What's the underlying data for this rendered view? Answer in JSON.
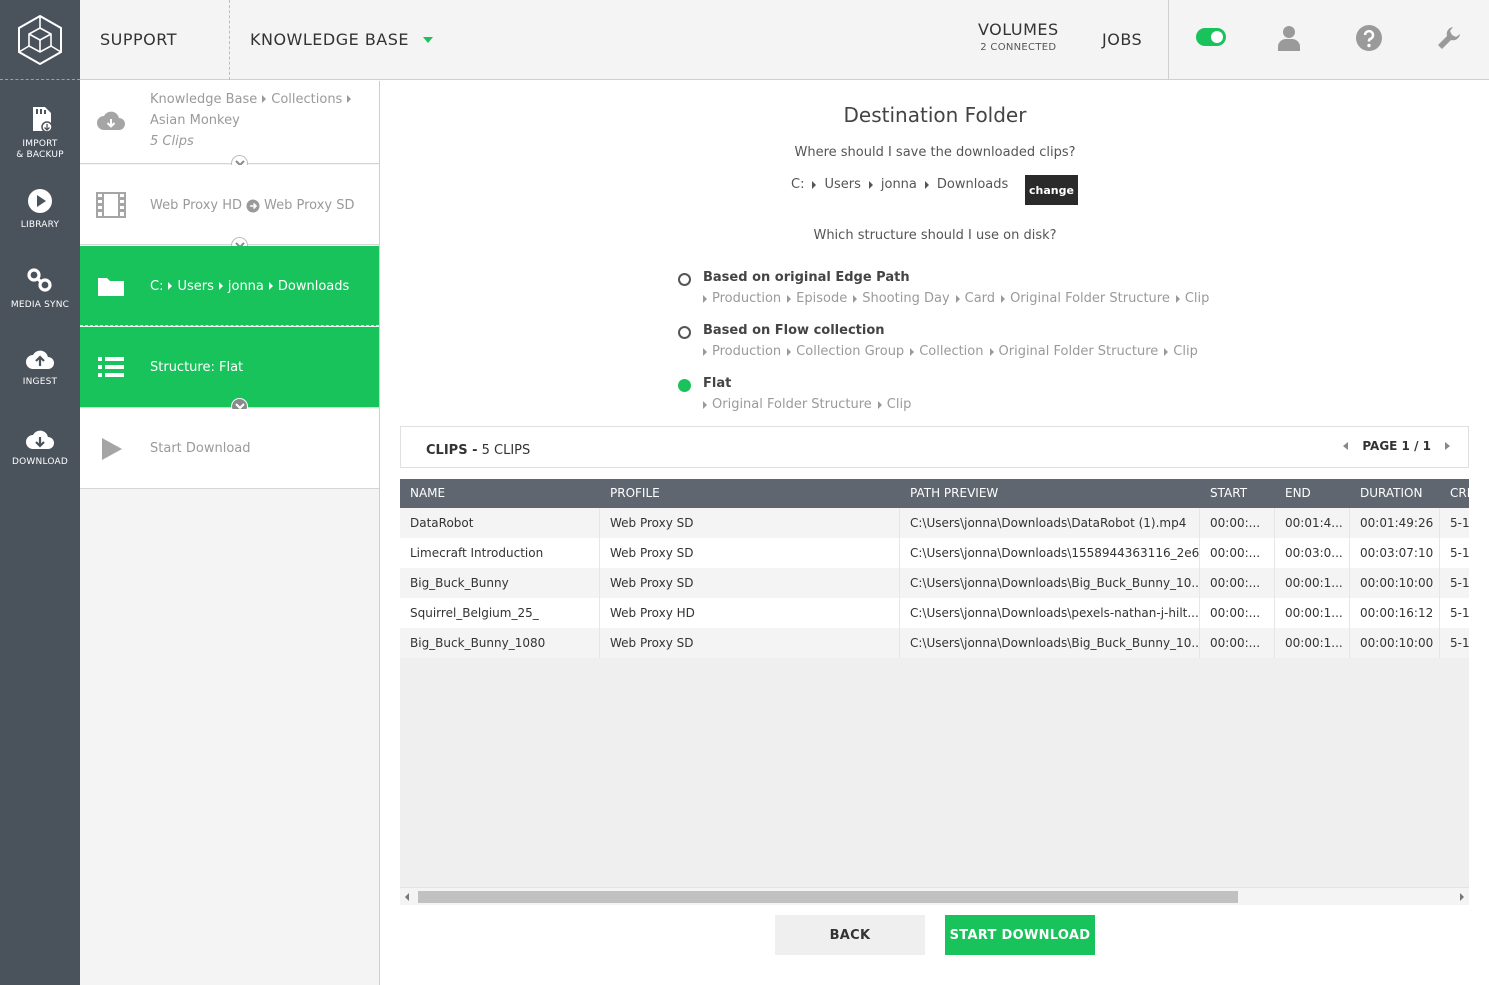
{
  "rail": {
    "items": [
      {
        "label": "IMPORT\n& BACKUP",
        "icon": "sd-card-icon"
      },
      {
        "label": "LIBRARY",
        "icon": "play-circle-icon"
      },
      {
        "label": "MEDIA SYNC",
        "icon": "link-icon"
      },
      {
        "label": "INGEST",
        "icon": "cloud-upload-icon"
      },
      {
        "label": "DOWNLOAD",
        "icon": "cloud-download-icon"
      }
    ]
  },
  "topbar": {
    "support": "SUPPORT",
    "knowledge_base": "KNOWLEDGE BASE",
    "volumes": "VOLUMES",
    "volumes_sub": "2 CONNECTED",
    "jobs": "JOBS"
  },
  "steps": {
    "source": {
      "crumb1": "Knowledge Base",
      "crumb2": "Collections",
      "crumb3": "Asian Monkey",
      "count": "5 Clips"
    },
    "profile": {
      "from": "Web Proxy HD",
      "to": "Web Proxy SD"
    },
    "folder": {
      "p1": "C:",
      "p2": "Users",
      "p3": "jonna",
      "p4": "Downloads"
    },
    "structure": "Structure: Flat",
    "start": "Start Download"
  },
  "destination": {
    "title": "Destination Folder",
    "question": "Where should I save the downloaded clips?",
    "path": [
      "C:",
      "Users",
      "jonna",
      "Downloads"
    ],
    "change": "change",
    "structure_question": "Which structure should I use on disk?",
    "options": [
      {
        "label": "Based on original Edge Path",
        "path": [
          "Production",
          "Episode",
          "Shooting Day",
          "Card",
          "Original Folder Structure",
          "Clip"
        ],
        "selected": false
      },
      {
        "label": "Based on Flow collection",
        "path": [
          "Production",
          "Collection Group",
          "Collection",
          "Original Folder Structure",
          "Clip"
        ],
        "selected": false
      },
      {
        "label": "Flat",
        "path": [
          "Original Folder Structure",
          "Clip"
        ],
        "selected": true
      }
    ]
  },
  "clips": {
    "title": "CLIPS -",
    "count": "5 CLIPS",
    "page": "PAGE 1 / 1",
    "columns": [
      "NAME",
      "PROFILE",
      "PATH PREVIEW",
      "START",
      "END",
      "DURATION",
      "CRE"
    ],
    "rows": [
      [
        "DataRobot",
        "Web Proxy SD",
        "C:\\Users\\jonna\\Downloads\\DataRobot (1).mp4",
        "00:00:...",
        "00:01:4...",
        "00:01:49:26",
        "5-1"
      ],
      [
        "Limecraft Introduction",
        "Web Proxy SD",
        "C:\\Users\\jonna\\Downloads\\1558944363116_2e6...",
        "00:00:...",
        "00:03:0...",
        "00:03:07:10",
        "5-1"
      ],
      [
        "Big_Buck_Bunny",
        "Web Proxy SD",
        "C:\\Users\\jonna\\Downloads\\Big_Buck_Bunny_10...",
        "00:00:...",
        "00:00:1...",
        "00:00:10:00",
        "5-1"
      ],
      [
        "Squirrel_Belgium_25_",
        "Web Proxy HD",
        "C:\\Users\\jonna\\Downloads\\pexels-nathan-j-hilt...",
        "00:00:...",
        "00:00:1...",
        "00:00:16:12",
        "5-1"
      ],
      [
        "Big_Buck_Bunny_1080",
        "Web Proxy SD",
        "C:\\Users\\jonna\\Downloads\\Big_Buck_Bunny_10...",
        "00:00:...",
        "00:00:1...",
        "00:00:10:00",
        "5-1"
      ]
    ]
  },
  "actions": {
    "back": "BACK",
    "start": "START DOWNLOAD"
  },
  "colors": {
    "accent": "#17c35a",
    "rail": "#4a525c",
    "table_header": "#5f6670"
  }
}
